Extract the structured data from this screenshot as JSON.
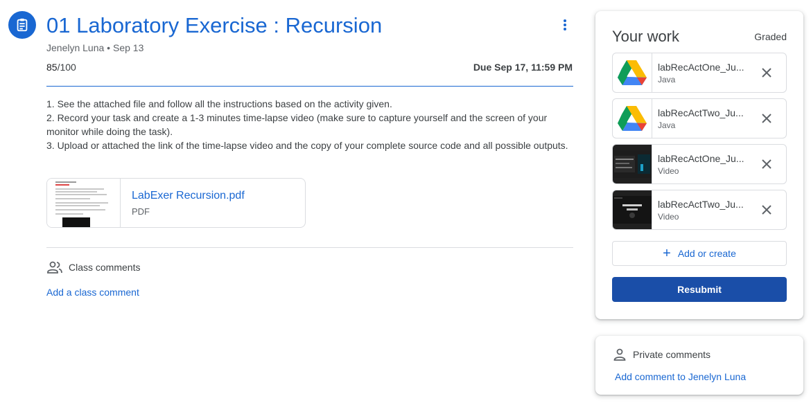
{
  "assignment": {
    "icon": "assignment-icon",
    "title": "01 Laboratory Exercise : Recursion",
    "author": "Jenelyn Luna",
    "separator": " • ",
    "posted": "Sep 13",
    "points_earned": "85",
    "points_total": "/100",
    "due": "Due Sep 17, 11:59 PM",
    "instructions": [
      "1. See the attached file and follow all the instructions based on the activity given.",
      "2. Record your task and create a 1-3 minutes time-lapse video (make sure to capture yourself and the screen of your monitor while doing the task).",
      "3. Upload or attached the link of the time-lapse video and the copy of your complete source code and all possible outputs."
    ],
    "attachment": {
      "name": "LabExer Recursion.pdf",
      "type": "PDF"
    }
  },
  "class_comments": {
    "icon": "people-icon",
    "label": "Class comments",
    "add": "Add a class comment"
  },
  "your_work": {
    "title": "Your work",
    "status": "Graded",
    "files": [
      {
        "name": "labRecActOne_Ju...",
        "type": "Java",
        "thumb": "google-drive-icon"
      },
      {
        "name": "labRecActTwo_Ju...",
        "type": "Java",
        "thumb": "google-drive-icon"
      },
      {
        "name": "labRecActOne_Ju...",
        "type": "Video",
        "thumb": "video-thumbnail"
      },
      {
        "name": "labRecActTwo_Ju...",
        "type": "Video",
        "thumb": "video-thumbnail"
      }
    ],
    "add_or_create": "Add or create",
    "resubmit": "Resubmit"
  },
  "private_comments": {
    "icon": "person-icon",
    "label": "Private comments",
    "add": "Add comment to Jenelyn Luna"
  },
  "colors": {
    "accent": "#1967d2",
    "button": "#1a4ea8",
    "text": "#3c4043",
    "muted": "#5f6368",
    "border": "#dadce0"
  }
}
